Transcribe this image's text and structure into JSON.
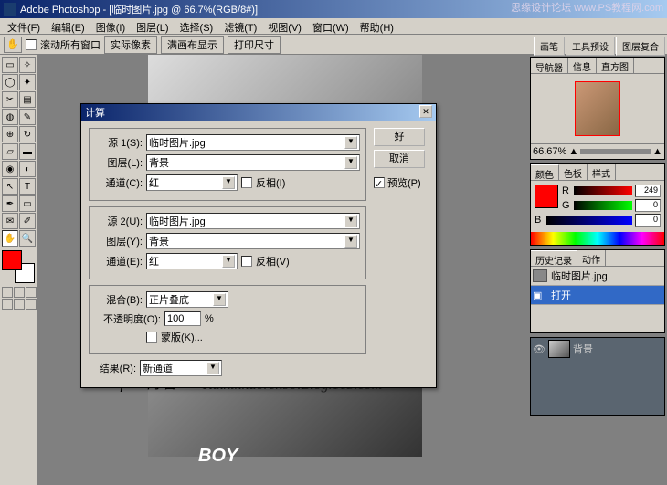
{
  "titlebar": {
    "app": "Adobe Photoshop",
    "doc": "[临时图片.jpg @ 66.7%(RGB/8#)]"
  },
  "topright": "思缘设计论坛  www.PS教程网.com",
  "menu": [
    "文件(F)",
    "编辑(E)",
    "图像(I)",
    "图层(L)",
    "选择(S)",
    "滤镜(T)",
    "视图(V)",
    "窗口(W)",
    "帮助(H)"
  ],
  "options": {
    "scroll_all": "滚动所有窗口",
    "btn1": "实际像素",
    "btn2": "满画布显示",
    "btn3": "打印尺寸"
  },
  "tabs_right": [
    "画笔",
    "工具预设",
    "图层复合"
  ],
  "dialog": {
    "title": "计算",
    "ok": "好",
    "cancel": "取消",
    "preview": "预览(P)",
    "src1": {
      "label": "源 1(S):",
      "val": "临时图片.jpg",
      "layer_lbl": "图层(L):",
      "layer": "背景",
      "chan_lbl": "通道(C):",
      "chan": "红",
      "invert": "反相(I)"
    },
    "src2": {
      "label": "源 2(U):",
      "val": "临时图片.jpg",
      "layer_lbl": "图层(Y):",
      "layer": "背景",
      "chan_lbl": "通道(E):",
      "chan": "红",
      "invert": "反相(V)"
    },
    "blend": {
      "label": "混合(B):",
      "val": "正片叠底"
    },
    "opacity": {
      "label": "不透明度(O):",
      "val": "100",
      "pct": "%"
    },
    "mask": "蒙版(K)...",
    "result": {
      "label": "结果(R):",
      "val": "新通道"
    }
  },
  "nav": {
    "tabs": [
      "导航器",
      "信息",
      "直方图"
    ],
    "zoom": "66.67%"
  },
  "color": {
    "tabs": [
      "颜色",
      "色板",
      "样式"
    ],
    "r": "249",
    "g": "0",
    "b": "0"
  },
  "hist": {
    "tabs": [
      "历史记录",
      "动作"
    ],
    "doc": "临时图片.jpg",
    "step": "打开"
  },
  "layer": {
    "name": "背景"
  },
  "watermark": "Good fun 博客:",
  "watermark2": "Kaixinhaoren99.Blog.163.com",
  "boy": "BOY"
}
